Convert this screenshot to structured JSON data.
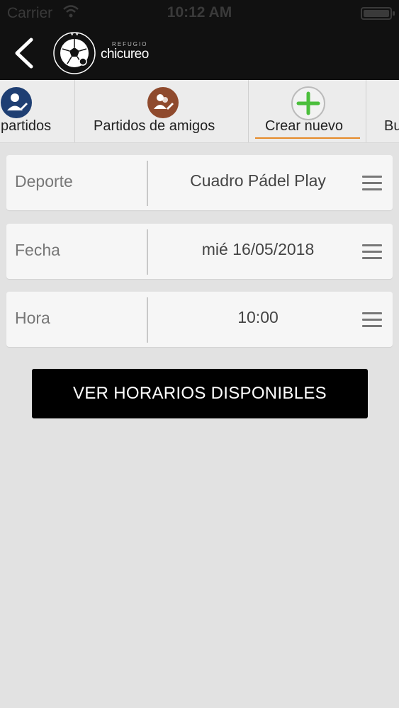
{
  "status_bar": {
    "carrier": "Carrier",
    "time": "10:12 AM"
  },
  "header": {
    "brand_small": "REFUGIO",
    "brand": "chicureo"
  },
  "tabs": [
    {
      "label": "partidos",
      "icon": "person-edit-icon",
      "icon_color": "#1f3f73"
    },
    {
      "label": "Partidos de amigos",
      "icon": "friends-edit-icon",
      "icon_color": "#8f4a2d"
    },
    {
      "label": "Crear nuevo",
      "icon": "plus-icon",
      "icon_color": "#4bbf3c",
      "active": true,
      "underline_color": "#e58a28"
    },
    {
      "label": "Bu"
    }
  ],
  "form": {
    "deporte": {
      "label": "Deporte",
      "value": "Cuadro Pádel Play"
    },
    "fecha": {
      "label": "Fecha",
      "value": "mié 16/05/2018"
    },
    "hora": {
      "label": "Hora",
      "value": "10:00"
    }
  },
  "cta": {
    "label": "VER HORARIOS DISPONIBLES"
  }
}
